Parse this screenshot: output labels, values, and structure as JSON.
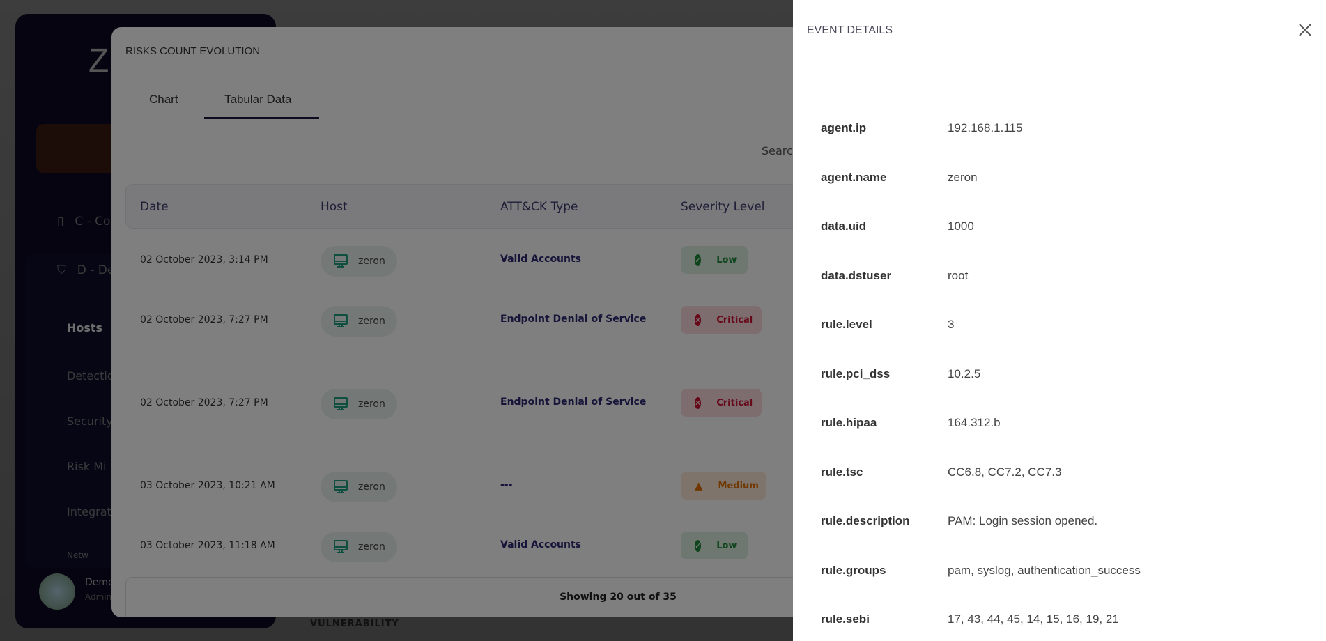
{
  "sidebar": {
    "logo": "Z",
    "items": [
      {
        "label": "C - Com",
        "icon": "document-icon"
      },
      {
        "label": "D - Defe",
        "icon": "shield-icon"
      },
      {
        "label": "Hosts"
      },
      {
        "label": "Detectio"
      },
      {
        "label": "Security"
      },
      {
        "label": "Risk Mi"
      },
      {
        "label": "Integrat"
      },
      {
        "label": "Netw"
      }
    ],
    "user": {
      "name": "Demo",
      "role": "Admin"
    }
  },
  "background": {
    "section_label": "VULNERABILITY"
  },
  "modal": {
    "title": "RISKS COUNT EVOLUTION",
    "tabs": [
      {
        "label": "Chart"
      },
      {
        "label": "Tabular Data",
        "active": true
      }
    ],
    "search_label": "Searc",
    "columns": [
      "Date",
      "Host",
      "ATT&CK Type",
      "Severity Level"
    ],
    "rows": [
      {
        "date": "02 October 2023, 3:14 PM",
        "host": "zeron",
        "attack_type": "Valid Accounts",
        "severity": "Low"
      },
      {
        "date": "02 October 2023, 7:27 PM",
        "host": "zeron",
        "attack_type": "Endpoint Denial of Service",
        "severity": "Critical"
      },
      {
        "date": "02 October 2023, 7:27 PM",
        "host": "zeron",
        "attack_type": "Endpoint Denial of Service",
        "severity": "Critical"
      },
      {
        "date": "03 October 2023, 10:21 AM",
        "host": "zeron",
        "attack_type": "---",
        "severity": "Medium"
      },
      {
        "date": "03 October 2023, 11:18 AM",
        "host": "zeron",
        "attack_type": "Valid Accounts",
        "severity": "Low"
      }
    ],
    "footer": "Showing 20 out of 35"
  },
  "severity_colors": {
    "Low": "#1f8a3a",
    "Critical": "#cc1030",
    "Medium": "#e07000"
  },
  "drawer": {
    "title": "EVENT DETAILS",
    "fields": [
      {
        "key": "agent.ip",
        "value": "192.168.1.115"
      },
      {
        "key": "agent.name",
        "value": "zeron"
      },
      {
        "key": "data.uid",
        "value": "1000"
      },
      {
        "key": "data.dstuser",
        "value": "root"
      },
      {
        "key": "rule.level",
        "value": "3"
      },
      {
        "key": "rule.pci_dss",
        "value": "10.2.5"
      },
      {
        "key": "rule.hipaa",
        "value": "164.312.b"
      },
      {
        "key": "rule.tsc",
        "value": "CC6.8, CC7.2, CC7.3"
      },
      {
        "key": "rule.description",
        "value": "PAM: Login session opened."
      },
      {
        "key": "rule.groups",
        "value": "pam, syslog, authentication_success"
      },
      {
        "key": "rule.sebi",
        "value": "17, 43, 44, 45, 14, 15, 16, 19, 21"
      }
    ]
  }
}
